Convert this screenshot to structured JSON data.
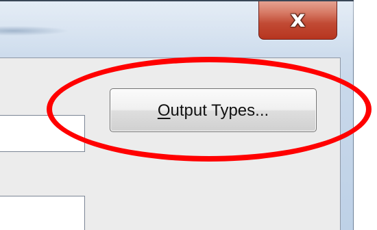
{
  "window": {
    "close_glyph": "x"
  },
  "button": {
    "mnemonic_letter": "O",
    "label_rest": "utput Types..."
  },
  "annotation": {
    "highlight_color": "#ff0000"
  },
  "icons": {
    "close": "close-icon"
  }
}
